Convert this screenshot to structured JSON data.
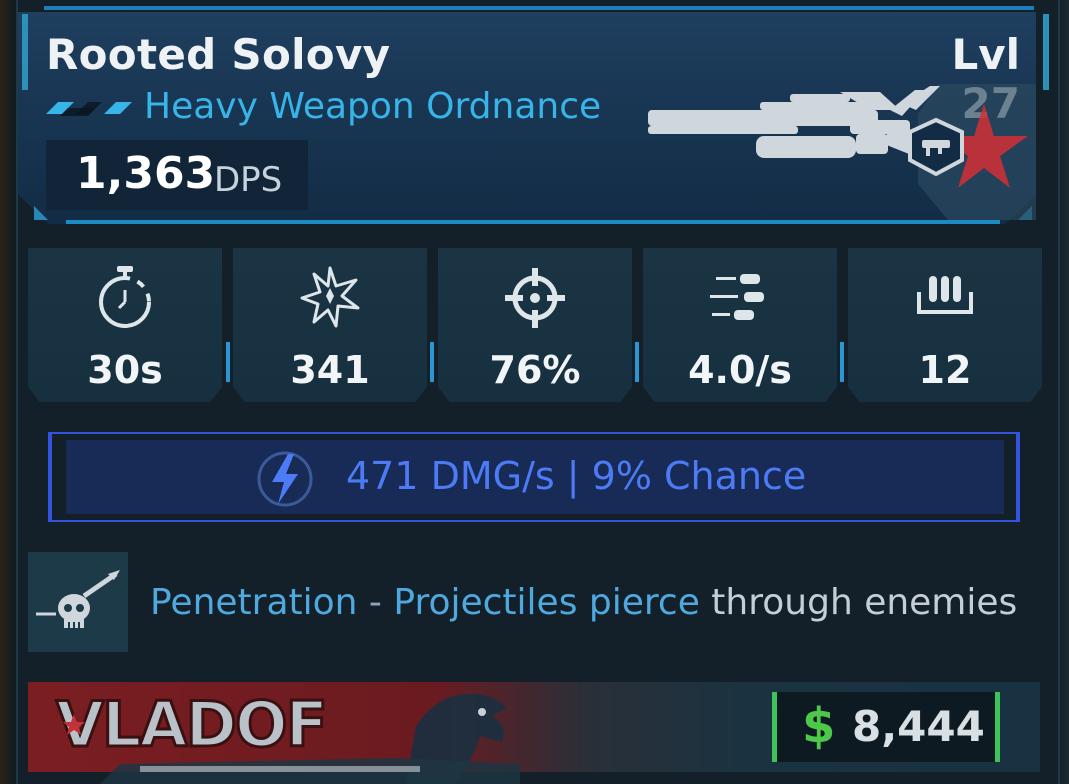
{
  "weapon": {
    "name": "Rooted Solovy",
    "level": "Lvl 27",
    "type": "Heavy Weapon Ordnance",
    "dps_value": "1,363",
    "dps_unit": "DPS"
  },
  "stats": [
    {
      "icon": "reload-timer-icon",
      "value": "30s"
    },
    {
      "icon": "damage-burst-icon",
      "value": "341"
    },
    {
      "icon": "accuracy-crosshair-icon",
      "value": "76%"
    },
    {
      "icon": "fire-rate-bullets-icon",
      "value": "4.0/s"
    },
    {
      "icon": "magazine-ammo-icon",
      "value": "12"
    }
  ],
  "element": {
    "icon": "shock-lightning-icon",
    "text": "471 DMG/s | 9% Chance",
    "color": "#4d7bf5"
  },
  "perk": {
    "icon": "skull-projectile-icon",
    "name": "Penetration",
    "separator": " - ",
    "highlight": "Projectiles pierce",
    "rest": " through enemies"
  },
  "manufacturer": {
    "logo_text": "VLADOF",
    "color": "#7b1e22"
  },
  "price": {
    "symbol": "$",
    "value": "8,444"
  },
  "colors": {
    "accent": "#37b4e8",
    "header_bg": "#1f3f5f",
    "price_green": "#3ec25a"
  }
}
